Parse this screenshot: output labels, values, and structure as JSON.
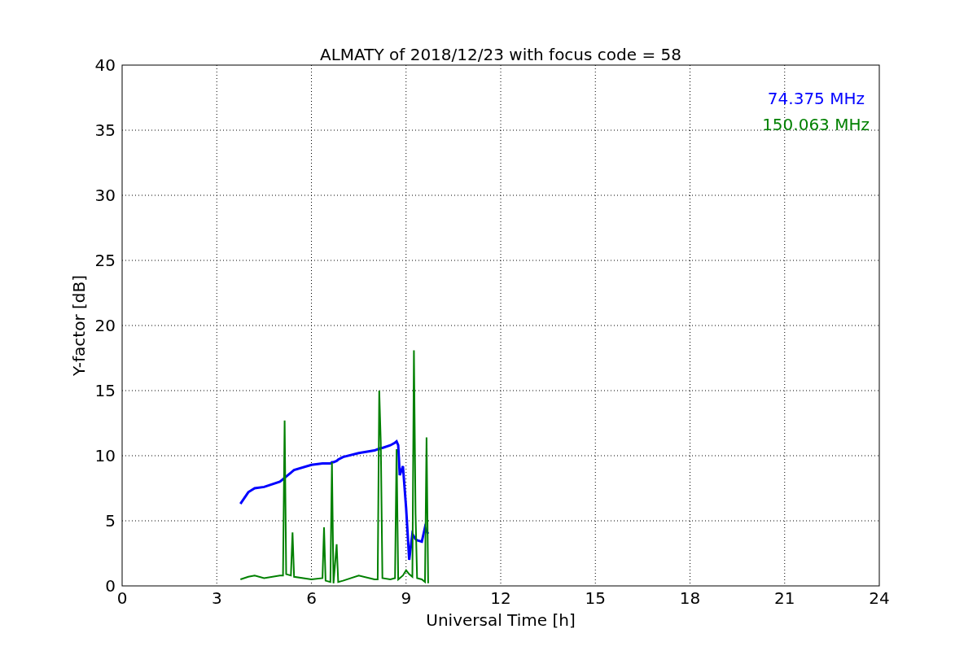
{
  "chart_data": {
    "type": "line",
    "title": "ALMATY of 2018/12/23 with focus code = 58",
    "xlabel": "Universal Time [h]",
    "ylabel": "Y-factor [dB]",
    "x": [
      3.75,
      4.0,
      4.2,
      4.5,
      5.0,
      5.1,
      5.15,
      5.2,
      5.35,
      5.4,
      5.45,
      6.0,
      6.35,
      6.4,
      6.45,
      6.6,
      6.65,
      6.7,
      6.8,
      6.85,
      7.0,
      7.5,
      8.0,
      8.1,
      8.15,
      8.2,
      8.25,
      8.5,
      8.65,
      8.7,
      8.75,
      8.8,
      8.9,
      9.0,
      9.1,
      9.2,
      9.25,
      9.3,
      9.35,
      9.5,
      9.6,
      9.65,
      9.7
    ],
    "series": [
      {
        "name": "74.375 MHz",
        "color": "#0000ff",
        "values": [
          6.3,
          7.2,
          7.5,
          7.6,
          8.0,
          8.2,
          8.3,
          8.4,
          8.7,
          8.8,
          8.9,
          9.3,
          9.4,
          9.4,
          9.4,
          9.4,
          9.5,
          9.5,
          9.6,
          9.7,
          9.9,
          10.2,
          10.4,
          10.5,
          10.5,
          10.6,
          10.6,
          10.8,
          11.0,
          11.1,
          10.8,
          8.5,
          9.2,
          6.0,
          2.0,
          4.0,
          3.8,
          3.6,
          3.5,
          3.4,
          4.5,
          4.2,
          4.0
        ]
      },
      {
        "name": "150.063 MHz",
        "color": "#008000",
        "values": [
          0.5,
          0.7,
          0.8,
          0.6,
          0.8,
          0.8,
          12.7,
          0.9,
          0.8,
          4.1,
          0.7,
          0.5,
          0.6,
          4.5,
          0.4,
          0.3,
          9.5,
          0.2,
          3.2,
          0.3,
          0.4,
          0.8,
          0.5,
          0.5,
          15.0,
          11.0,
          0.6,
          0.5,
          0.6,
          10.5,
          0.5,
          0.6,
          0.8,
          1.2,
          0.9,
          0.7,
          18.1,
          5.5,
          0.6,
          0.5,
          0.3,
          11.4,
          0.2
        ]
      }
    ],
    "grid": true,
    "xlim": [
      0,
      24
    ],
    "ylim": [
      0,
      40
    ],
    "xticks": [
      0,
      3,
      6,
      9,
      12,
      15,
      18,
      21,
      24
    ],
    "yticks": [
      0,
      5,
      10,
      15,
      20,
      25,
      30,
      35,
      40
    ]
  }
}
